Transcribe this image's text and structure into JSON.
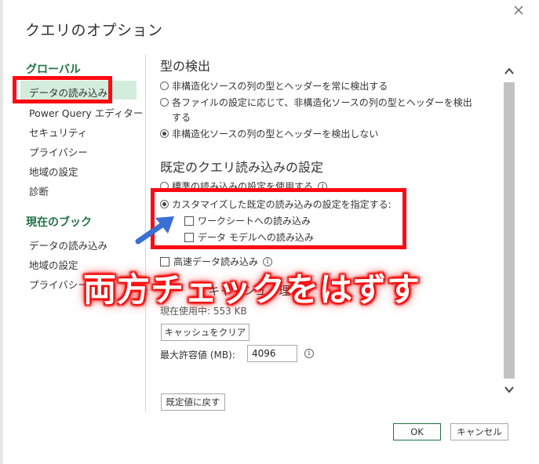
{
  "window": {
    "title": "クエリのオプション"
  },
  "sidebar": {
    "global_header": "グローバル",
    "global_items": [
      {
        "label": "データの読み込み",
        "selected": true
      },
      {
        "label": "Power Query エディター"
      },
      {
        "label": "セキュリティ"
      },
      {
        "label": "プライバシー"
      },
      {
        "label": "地域の設定"
      },
      {
        "label": "診断"
      }
    ],
    "book_header": "現在のブック",
    "book_items": [
      {
        "label": "データの読み込み"
      },
      {
        "label": "地域の設定"
      },
      {
        "label": "プライバシー"
      }
    ]
  },
  "type_detection": {
    "title": "型の検出",
    "options": [
      {
        "label": "非構造化ソースの列の型とヘッダーを常に検出する",
        "checked": false
      },
      {
        "label": "各ファイルの設定に応じて、非構造化ソースの列の型とヘッダーを検出",
        "label_line2": "する",
        "checked": false
      },
      {
        "label": "非構造化ソースの列の型とヘッダーを検出しない",
        "checked": true
      }
    ]
  },
  "default_load": {
    "title": "既定のクエリ読み込みの設定",
    "standard_option": "標準の読み込みの設定を使用する",
    "custom_option": "カスタマイズした既定の読み込みの設定を指定する:",
    "worksheet_load": "ワークシートへの読み込み",
    "datamodel_load": "データ モデルへの読み込み"
  },
  "fast_load": {
    "label": "高速データ読み込み"
  },
  "cache": {
    "title_visible_start": "デー",
    "title_visible_mid": "キャッシュ",
    "title_visible_end": "理オプ",
    "current_usage": "現在使用中: 553 KB",
    "clear_button": "キャッシュをクリア",
    "max_label": "最大許容値 (MB):",
    "max_value": "4096"
  },
  "buttons": {
    "restore_defaults": "既定値に戻す",
    "ok": "OK",
    "cancel": "キャンセル"
  },
  "annotation": {
    "text": "両方チェックをはずす"
  },
  "colors": {
    "accent": "#217346",
    "highlight_red": "#ff0a12",
    "selected_bg": "#d3eddc",
    "arrow_blue": "#3a6fd3"
  }
}
